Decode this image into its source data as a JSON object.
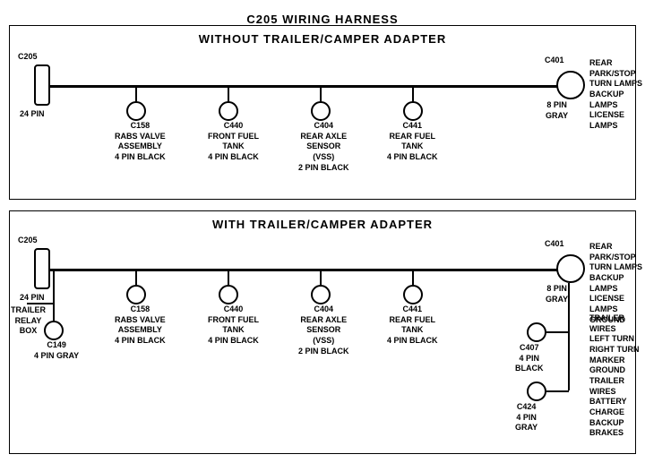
{
  "title": "C205 WIRING HARNESS",
  "section1": {
    "label": "WITHOUT  TRAILER/CAMPER  ADAPTER",
    "connectors": [
      {
        "id": "C205_1",
        "label": "C205",
        "sublabel": "24 PIN"
      },
      {
        "id": "C158_1",
        "label": "C158",
        "sublabel": "RABS VALVE\nASSEMBLY\n4 PIN BLACK"
      },
      {
        "id": "C440_1",
        "label": "C440",
        "sublabel": "FRONT FUEL\nTANK\n4 PIN BLACK"
      },
      {
        "id": "C404_1",
        "label": "C404",
        "sublabel": "REAR AXLE\nSENSOR\n(VSS)\n2 PIN BLACK"
      },
      {
        "id": "C441_1",
        "label": "C441",
        "sublabel": "REAR FUEL\nTANK\n4 PIN BLACK"
      },
      {
        "id": "C401_1",
        "label": "C401",
        "sublabel": "8 PIN\nGRAY"
      }
    ],
    "c401_labels": "REAR PARK/STOP\nTURN LAMPS\nBACKUP LAMPS\nLICENSE LAMPS"
  },
  "section2": {
    "label": "WITH  TRAILER/CAMPER  ADAPTER",
    "connectors": [
      {
        "id": "C205_2",
        "label": "C205",
        "sublabel": "24 PIN"
      },
      {
        "id": "C158_2",
        "label": "C158",
        "sublabel": "RABS VALVE\nASSEMBLY\n4 PIN BLACK"
      },
      {
        "id": "C440_2",
        "label": "C440",
        "sublabel": "FRONT FUEL\nTANK\n4 PIN BLACK"
      },
      {
        "id": "C404_2",
        "label": "C404",
        "sublabel": "REAR AXLE\nSENSOR\n(VSS)\n2 PIN BLACK"
      },
      {
        "id": "C441_2",
        "label": "C441",
        "sublabel": "REAR FUEL\nTANK\n4 PIN BLACK"
      },
      {
        "id": "C401_2",
        "label": "C401",
        "sublabel": "8 PIN\nGRAY"
      }
    ],
    "c401_labels": "REAR PARK/STOP\nTURN LAMPS\nBACKUP LAMPS\nLICENSE LAMPS\nGROUND",
    "c407_labels": "TRAILER WIRES\nLEFT TURN\nRIGHT TURN\nMARKER\nGROUND",
    "c407": {
      "label": "C407",
      "sublabel": "4 PIN\nBLACK"
    },
    "c424_labels": "TRAILER WIRES\nBATTERY CHARGE\nBACKUP\nBRAKES",
    "c424": {
      "label": "C424",
      "sublabel": "4 PIN\nGRAY"
    },
    "c149": {
      "label": "C149",
      "sublabel": "4 PIN GRAY"
    },
    "trailer_relay": "TRAILER\nRELAY\nBOX"
  }
}
